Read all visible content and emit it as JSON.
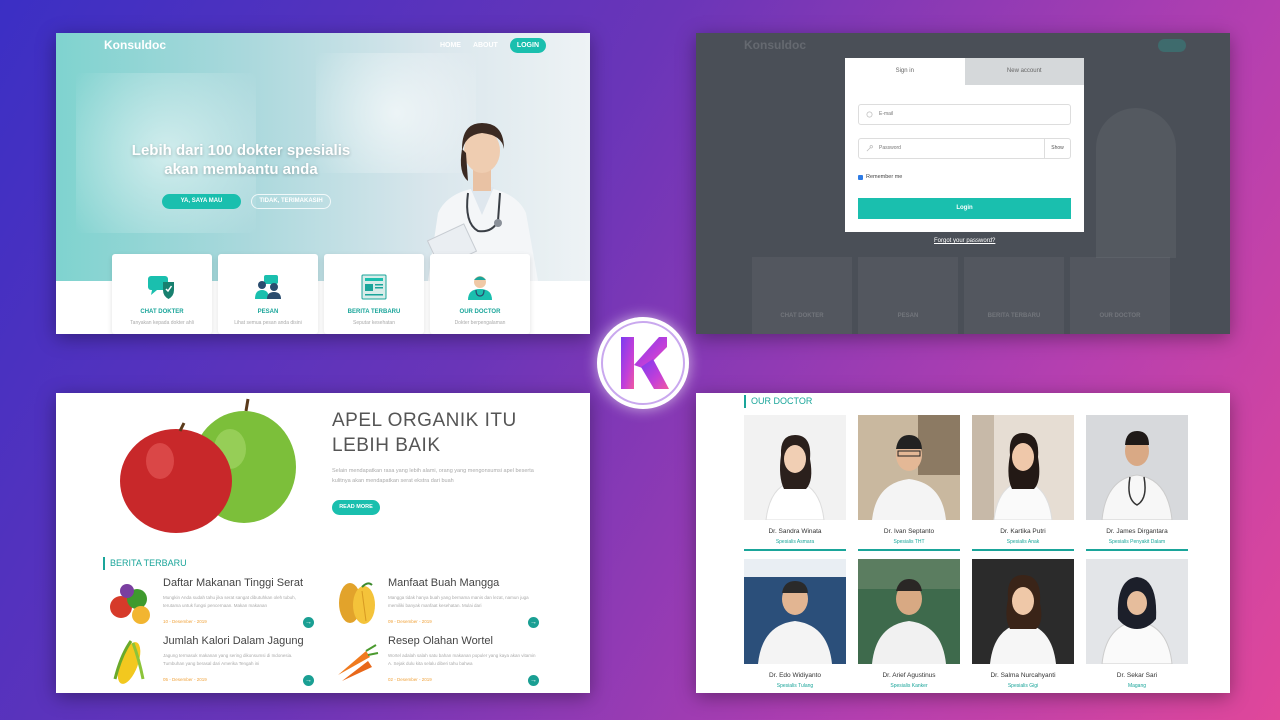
{
  "colors": {
    "accent": "#1abfae",
    "accent_dark": "#1aa59a",
    "date": "#f0a23a"
  },
  "landing": {
    "brand": "Konsuldoc",
    "nav": [
      "HOME",
      "ABOUT"
    ],
    "login_label": "LOGIN",
    "hero_title": "Lebih dari 100 dokter spesialis akan membantu anda",
    "btn_yes": "YA, SAYA MAU",
    "btn_no": "TIDAK, TERIMAKASIH",
    "cards": [
      {
        "title": "CHAT DOKTER",
        "sub": "Tanyakan kepada dokter ahli",
        "icon": "chat-shield-icon"
      },
      {
        "title": "PESAN",
        "sub": "Lihat semua pesan anda disini",
        "icon": "people-icon"
      },
      {
        "title": "BERITA TERBARU",
        "sub": "Seputar kesehatan",
        "icon": "newspaper-icon"
      },
      {
        "title": "OUR DOCTOR",
        "sub": "Dokter berpengalaman",
        "icon": "doctor-icon"
      }
    ]
  },
  "login_modal": {
    "brand": "Konsuldoc",
    "tab_signin": "Sign in",
    "tab_new": "New account",
    "email_placeholder": "E-mail",
    "password_placeholder": "Password",
    "show_label": "Show",
    "remember_label": "Remember me",
    "login_button": "Login",
    "forgot_link": "Forgot your password?",
    "bg_cards": [
      "CHAT DOKTER",
      "PESAN",
      "BERITA TERBARU",
      "OUR DOCTOR"
    ]
  },
  "article": {
    "title": "APEL ORGANIK ITU LEBIH BAIK",
    "body": "Selain mendapatkan rasa yang lebih alami, orang yang mengonsumsi apel beserta kulitnya akan mendapatkan serat ekstra dari buah",
    "read_more": "READ MORE",
    "section_title": "BERITA TERBARU",
    "news": [
      {
        "title": "Daftar Makanan Tinggi Serat",
        "body": "Mungkin Anda sudah tahu jika serat sangat dibutuhkan oleh tubuh, terutama untuk fungsi pencernaan. Makan makanan",
        "date": "10 - Desember - 2019"
      },
      {
        "title": "Manfaat Buah Mangga",
        "body": "Mangga tidak hanya buah yang bernama manis dan lezat, namun juga memiliki banyak manfaat kesehatan. Mulai dari",
        "date": "09 - Desember - 2019"
      },
      {
        "title": "Jumlah Kalori Dalam Jagung",
        "body": "Jagung termasuk makanan yang sering dikonsumsi di Indonesia. Tumbuhan yang berasal dari Amerika Tengah ini",
        "date": "05 - Desember - 2019"
      },
      {
        "title": "Resep Olahan Wortel",
        "body": "Wortel adalah salah satu bahan makanan populer yang kaya akan vitamin A. Sejak dulu kita selalu diberi tahu bahwa",
        "date": "02 - Desember - 2019"
      }
    ]
  },
  "doctors": {
    "section_title": "OUR DOCTOR",
    "list": [
      {
        "name": "Dr. Sandra Winata",
        "spec": "Spesialis Asmara"
      },
      {
        "name": "Dr. Ivan Septanto",
        "spec": "Spesialis THT"
      },
      {
        "name": "Dr. Kartika Putri",
        "spec": "Spesialis Anak"
      },
      {
        "name": "Dr. James Dirgantara",
        "spec": "Spesialis Penyakit Dalam"
      },
      {
        "name": "Dr. Edo Widiyanto",
        "spec": "Spesialis Tulang"
      },
      {
        "name": "Dr. Arief Agustinus",
        "spec": "Spesialis Kanker"
      },
      {
        "name": "Dr. Salma Nurcahyanti",
        "spec": "Spesialis Gigi"
      },
      {
        "name": "Dr. Sekar Sari",
        "spec": "Magang"
      }
    ]
  },
  "logo": {
    "letter": "K"
  }
}
